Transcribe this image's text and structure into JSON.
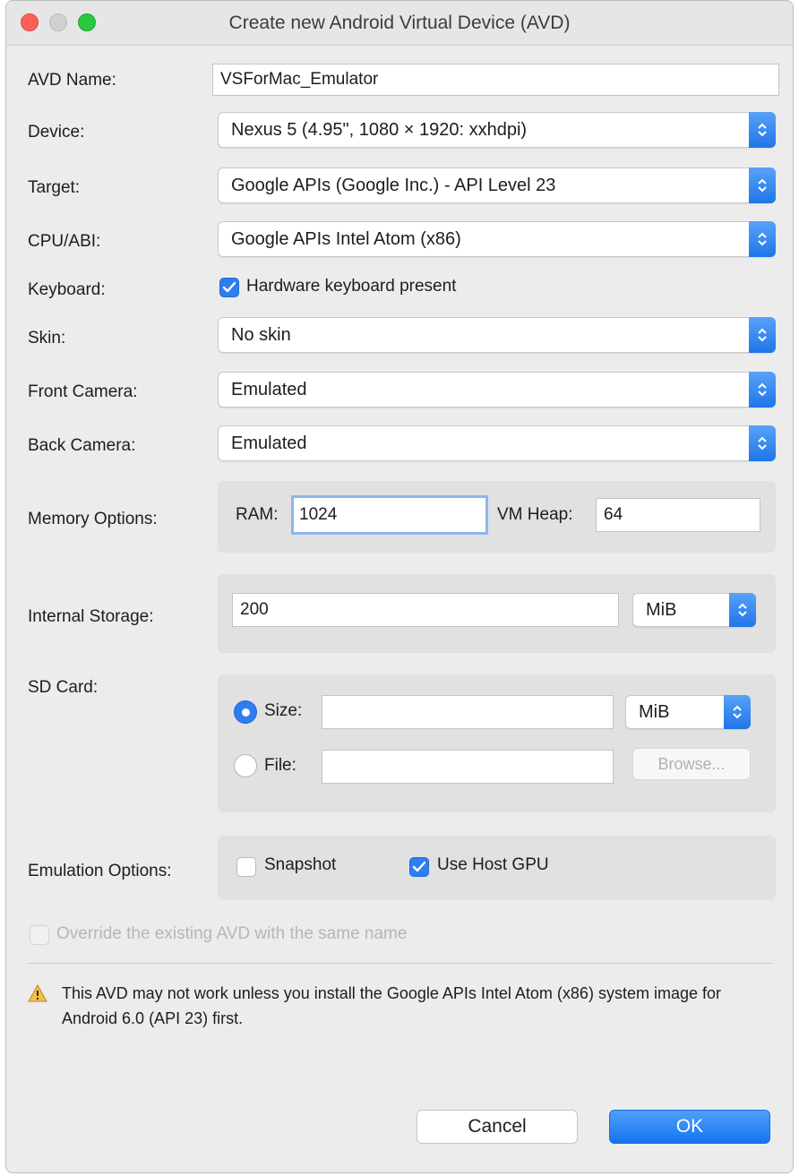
{
  "window": {
    "title": "Create new Android Virtual Device (AVD)"
  },
  "form": {
    "avd_name": {
      "label": "AVD Name:",
      "value": "VSForMac_Emulator"
    },
    "device": {
      "label": "Device:",
      "value": "Nexus 5 (4.95\", 1080 × 1920: xxhdpi)"
    },
    "target": {
      "label": "Target:",
      "value": "Google APIs (Google Inc.) - API Level 23"
    },
    "cpu_abi": {
      "label": "CPU/ABI:",
      "value": "Google APIs Intel Atom (x86)"
    },
    "keyboard": {
      "label": "Keyboard:",
      "checkbox_label": "Hardware keyboard present",
      "checked": true
    },
    "skin": {
      "label": "Skin:",
      "value": "No skin"
    },
    "front_camera": {
      "label": "Front Camera:",
      "value": "Emulated"
    },
    "back_camera": {
      "label": "Back Camera:",
      "value": "Emulated"
    },
    "memory": {
      "label": "Memory Options:",
      "ram_label": "RAM:",
      "ram_value": "1024",
      "vm_heap_label": "VM Heap:",
      "vm_heap_value": "64"
    },
    "internal_storage": {
      "label": "Internal Storage:",
      "value": "200",
      "unit": "MiB"
    },
    "sd_card": {
      "label": "SD Card:",
      "size_label": "Size:",
      "size_value": "",
      "size_unit": "MiB",
      "size_selected": true,
      "file_label": "File:",
      "file_value": "",
      "browse_label": "Browse..."
    },
    "emulation": {
      "label": "Emulation Options:",
      "snapshot_label": "Snapshot",
      "snapshot_checked": false,
      "host_gpu_label": "Use Host GPU",
      "host_gpu_checked": true
    },
    "override": {
      "label": "Override the existing AVD with the same name",
      "checked": false,
      "enabled": false
    }
  },
  "warning": {
    "icon": "warning-icon",
    "text": "This AVD may not work unless you install the Google APIs Intel Atom (x86) system image for Android 6.0 (API 23) first."
  },
  "buttons": {
    "cancel": "Cancel",
    "ok": "OK"
  },
  "colors": {
    "accent": "#2f7ef0",
    "window_bg": "#ececec",
    "group_bg": "#e1e1e1",
    "warning": "#e8b23c"
  }
}
